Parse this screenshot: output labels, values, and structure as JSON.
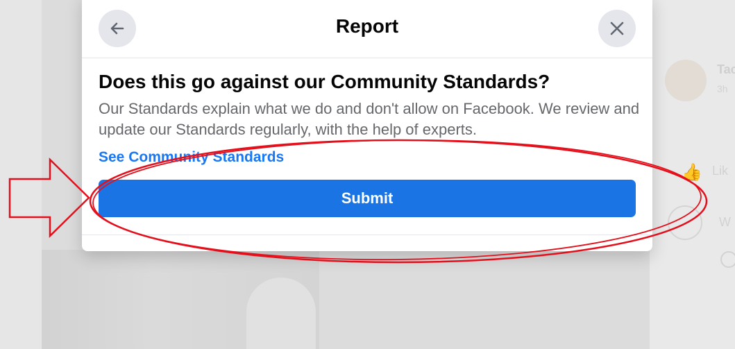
{
  "dialog": {
    "title": "Report",
    "back_icon": "arrow-left-icon",
    "close_icon": "close-icon",
    "heading": "Does this go against our Community Standards?",
    "description": "Our Standards explain what we do and don't allow on Facebook. We review and update our Standards regularly, with the help of experts.",
    "link_label": "See Community Standards",
    "submit_label": "Submit"
  },
  "background": {
    "name_fragment": "Tac",
    "time_fragment": "3h",
    "like_fragment": "Lik",
    "comment_fragment": "W"
  },
  "colors": {
    "primary_button": "#1b74e4",
    "link": "#1877f2",
    "annotation_red": "#e3101c"
  }
}
